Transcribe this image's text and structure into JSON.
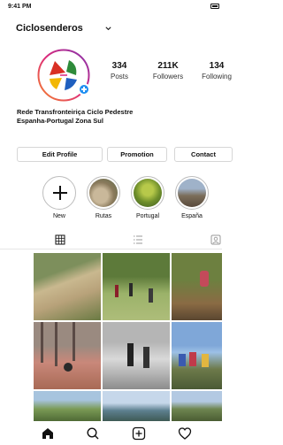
{
  "status": {
    "time": "9:41 PM"
  },
  "header": {
    "username": "Ciclosenderos"
  },
  "stats": [
    {
      "num": "334",
      "label": "Posts"
    },
    {
      "num": "211K",
      "label": "Followers"
    },
    {
      "num": "134",
      "label": "Following"
    }
  ],
  "bio": {
    "line1": "Rede Transfronteiriça Ciclo Pedestre",
    "line2": "Espanha-Portugal Zona Sul"
  },
  "buttons": {
    "edit_profile": "Edit Profile",
    "promotion": "Promotion",
    "contact": "Contact"
  },
  "highlights": [
    {
      "label": "New"
    },
    {
      "label": "Rutas"
    },
    {
      "label": "Portugal"
    },
    {
      "label": "España"
    }
  ],
  "colors": {
    "accent_blue": "#1f8ef1",
    "ring_gradient": [
      "#f58529",
      "#dd2a7b",
      "#8134af"
    ]
  },
  "icons": {
    "tabs": [
      "grid-icon",
      "list-icon",
      "tagged-icon"
    ],
    "nav": [
      "home-icon",
      "search-icon",
      "new-post-icon",
      "heart-icon"
    ]
  }
}
